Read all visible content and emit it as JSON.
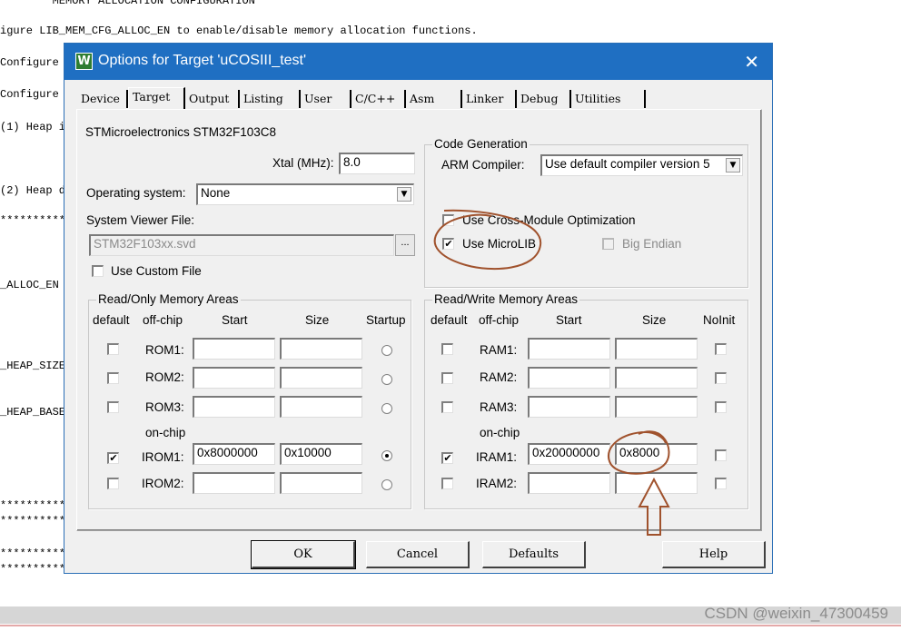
{
  "background_code": {
    "lines": [
      "        MEMORY ALLOCATION CONFIGURATION",
      "igure LIB_MEM_CFG_ALLOC_EN to enable/disable memory allocation functions.",
      "Configure",
      "Configure",
      "(1) Heap i",
      "(2) Heap d",
      "**********",
      "_ALLOC_EN",
      "_HEAP_SIZE",
      "_HEAP_BASE",
      "**********",
      "**********",
      "**********",
      "**********"
    ]
  },
  "watermark": "CSDN @weixin_47300459",
  "dialog": {
    "title": "Options for Target 'uCOSIII_test'",
    "icon_glyph": "W",
    "close_glyph": "✕",
    "tabs": [
      "Device",
      "Target",
      "Output",
      "Listing",
      "User",
      "C/C++",
      "Asm",
      "Linker",
      "Debug",
      "Utilities"
    ],
    "active_tab": "Target",
    "device_name": "STMicroelectronics STM32F103C8",
    "xtal_label": "Xtal (MHz):",
    "xtal_value": "8.0",
    "os_label": "Operating system:",
    "os_value": "None",
    "svd_label": "System Viewer File:",
    "svd_value": "STM32F103xx.svd",
    "svd_browse": "...",
    "custom_file_label": "Use Custom File",
    "code_generation": {
      "legend": "Code Generation",
      "compiler_label": "ARM Compiler:",
      "compiler_value": "Use default compiler version 5",
      "cross_module_label": "Use Cross-Module Optimization",
      "microlib_label": "Use MicroLIB",
      "big_endian_label": "Big Endian"
    },
    "ro_memory": {
      "legend": "Read/Only Memory Areas",
      "headers": [
        "default",
        "off-chip",
        "Start",
        "Size",
        "Startup"
      ],
      "onchip_label": "on-chip",
      "rows": [
        {
          "name": "ROM1:",
          "default": false,
          "start": "",
          "size": "",
          "startup": false
        },
        {
          "name": "ROM2:",
          "default": false,
          "start": "",
          "size": "",
          "startup": false
        },
        {
          "name": "ROM3:",
          "default": false,
          "start": "",
          "size": "",
          "startup": false
        },
        {
          "name": "IROM1:",
          "default": true,
          "start": "0x8000000",
          "size": "0x10000",
          "startup": true
        },
        {
          "name": "IROM2:",
          "default": false,
          "start": "",
          "size": "",
          "startup": false
        }
      ]
    },
    "rw_memory": {
      "legend": "Read/Write Memory Areas",
      "headers": [
        "default",
        "off-chip",
        "Start",
        "Size",
        "NoInit"
      ],
      "onchip_label": "on-chip",
      "rows": [
        {
          "name": "RAM1:",
          "default": false,
          "start": "",
          "size": "",
          "noinit": false
        },
        {
          "name": "RAM2:",
          "default": false,
          "start": "",
          "size": "",
          "noinit": false
        },
        {
          "name": "RAM3:",
          "default": false,
          "start": "",
          "size": "",
          "noinit": false
        },
        {
          "name": "IRAM1:",
          "default": true,
          "start": "0x20000000",
          "size": "0x8000",
          "noinit": false
        },
        {
          "name": "IRAM2:",
          "default": false,
          "start": "",
          "size": "",
          "noinit": false
        }
      ]
    },
    "buttons": {
      "ok": "OK",
      "cancel": "Cancel",
      "defaults": "Defaults",
      "help": "Help"
    }
  },
  "colors": {
    "titlebar": "#1f6fc2",
    "annotation": "#a0522d"
  }
}
